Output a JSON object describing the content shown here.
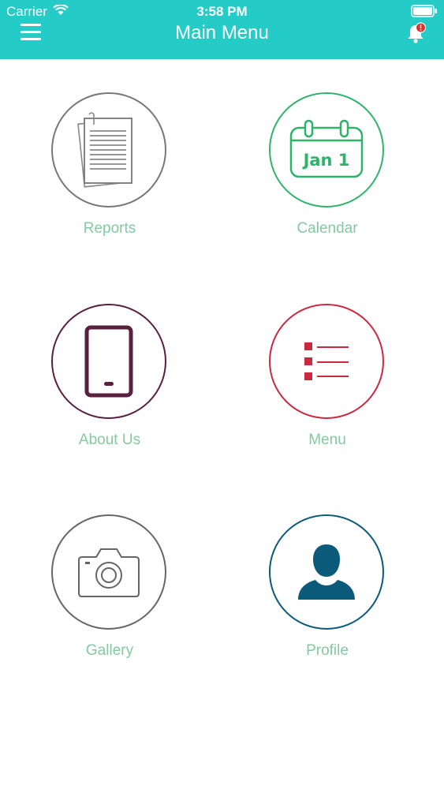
{
  "status_bar": {
    "carrier": "Carrier",
    "time": "3:58 PM"
  },
  "nav": {
    "title": "Main Menu",
    "left_icon": "hamburger-icon",
    "right_icon": "bell-alert-icon"
  },
  "colors": {
    "header": "#25cbc6",
    "label": "#84c9a0",
    "reports": "#777777",
    "calendar": "#2fb36b",
    "about": "#5a2040",
    "menu": "#cc2840",
    "gallery": "#666666",
    "profile": "#0b5a7a"
  },
  "tiles": [
    {
      "label": "Reports",
      "icon": "document-stack-icon"
    },
    {
      "label": "Calendar",
      "icon": "calendar-icon",
      "icon_text": "Jan 1"
    },
    {
      "label": "About Us",
      "icon": "tablet-icon"
    },
    {
      "label": "Menu",
      "icon": "list-icon"
    },
    {
      "label": "Gallery",
      "icon": "camera-icon"
    },
    {
      "label": "Profile",
      "icon": "user-icon"
    }
  ]
}
